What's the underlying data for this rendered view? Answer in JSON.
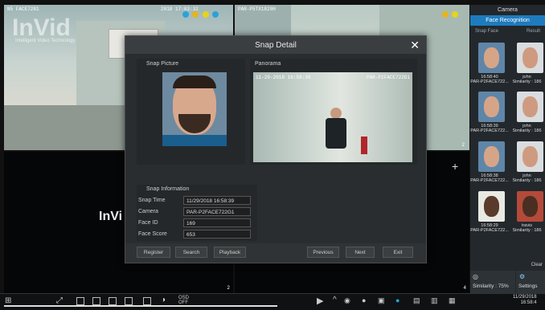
{
  "cameras": {
    "tl": {
      "osd_left": "N5 FACE7281",
      "osd_right": "2018 17:03:32"
    },
    "tr": {
      "osd": "PAR-P5TX1820H",
      "corner_num": "2"
    },
    "bl": {
      "corner_num": "2"
    },
    "br": {
      "corner_num": "4"
    }
  },
  "watermark": {
    "large": "InVid",
    "tagline": "Intelligent Video Technology",
    "small": "InVi"
  },
  "dialog": {
    "title": "Snap Detail",
    "snap_picture_label": "Snap Picture",
    "panorama_label": "Panorama",
    "panorama_osd_left": "11-29-2018 16:58:39",
    "panorama_osd_right": "PAR-P2FACE722G1",
    "snap_info_label": "Snap Information",
    "fields": [
      {
        "label": "Snap Time",
        "value": "11/29/2018 16:58:39"
      },
      {
        "label": "Camera",
        "value": "PAR-P2FACE722G1"
      },
      {
        "label": "Face ID",
        "value": "169"
      },
      {
        "label": "Face Score",
        "value": "653"
      }
    ],
    "buttons": {
      "register": "Register",
      "search": "Search",
      "playback": "Playback",
      "previous": "Previous",
      "next": "Next",
      "exit": "Exit"
    }
  },
  "sidebar": {
    "title": "Camera",
    "tab": "Face Recognition",
    "col_snap": "Snap Face",
    "col_result": "Result",
    "items": [
      {
        "time": "16:58:40",
        "cam": "PAR-P2FACE722...",
        "name": "john",
        "sim": "Similarity : 186"
      },
      {
        "time": "16:58:39",
        "cam": "PAR-P2FACE722...",
        "name": "john",
        "sim": "Similarity : 186"
      },
      {
        "time": "16:58:38",
        "cam": "PAR-P2FACE722...",
        "name": "john",
        "sim": "Similarity : 186"
      },
      {
        "time": "16:58:29",
        "cam": "PAR-P2FACE722...",
        "name": "travis",
        "sim": "Similarity : 186"
      }
    ],
    "clear": "Clear",
    "similarity": "Similarity : 75%",
    "settings": "Settings"
  },
  "toolbar": {
    "osd_label": "OSD",
    "osd_state": "OFF",
    "date": "11/29/2018",
    "time": "16:58:4"
  },
  "colors": {
    "accent": "#1e7bbd",
    "panel": "#2a2d2f"
  }
}
